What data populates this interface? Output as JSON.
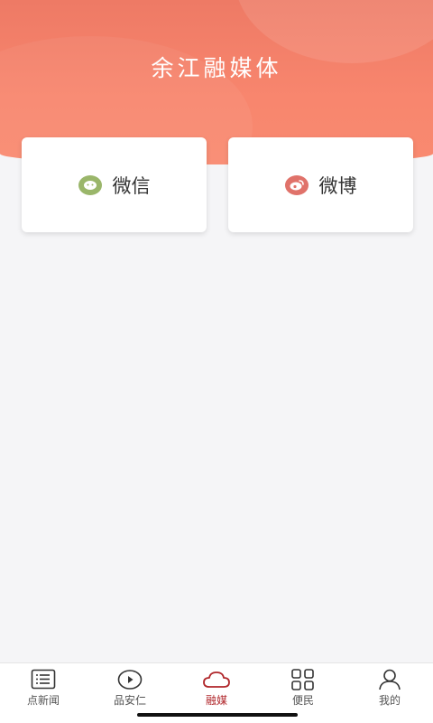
{
  "header": {
    "title": "余江融媒体"
  },
  "cards": [
    {
      "label": "微信",
      "icon": "wechat-icon",
      "color": "#9ab66a"
    },
    {
      "label": "微博",
      "icon": "weibo-icon",
      "color": "#e0726a"
    }
  ],
  "tabbar": {
    "active_color": "#b0262a",
    "items": [
      {
        "label": "点新闻",
        "icon": "news-list-icon"
      },
      {
        "label": "品安仁",
        "icon": "play-video-icon"
      },
      {
        "label": "融媒",
        "icon": "cloud-icon",
        "active": true
      },
      {
        "label": "便民",
        "icon": "grid-apps-icon"
      },
      {
        "label": "我的",
        "icon": "user-profile-icon"
      }
    ]
  }
}
